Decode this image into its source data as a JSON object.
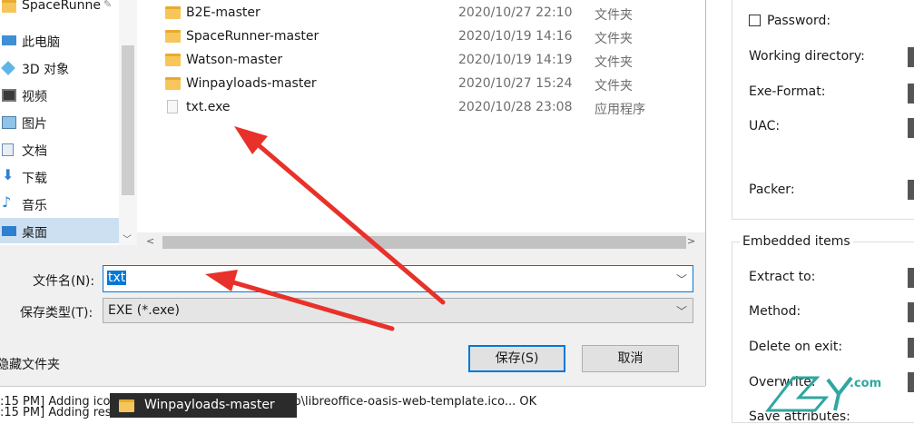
{
  "nav": {
    "items": [
      {
        "label": "SpaceRunne",
        "icon": "folder-icon"
      },
      {
        "label": "此电脑",
        "icon": "computer-icon"
      },
      {
        "label": "3D 对象",
        "icon": "cube-icon"
      },
      {
        "label": "视频",
        "icon": "video-icon"
      },
      {
        "label": "图片",
        "icon": "picture-icon"
      },
      {
        "label": "文档",
        "icon": "document-icon"
      },
      {
        "label": "下载",
        "icon": "download-icon"
      },
      {
        "label": "音乐",
        "icon": "music-icon"
      },
      {
        "label": "桌面",
        "icon": "desktop-icon"
      }
    ]
  },
  "files": [
    {
      "name": "B2E-master",
      "date": "2020/10/27 22:10",
      "type": "文件夹"
    },
    {
      "name": "SpaceRunner-master",
      "date": "2020/10/19 14:16",
      "type": "文件夹"
    },
    {
      "name": "Watson-master",
      "date": "2020/10/19 14:19",
      "type": "文件夹"
    },
    {
      "name": "Winpayloads-master",
      "date": "2020/10/27 15:24",
      "type": "文件夹"
    },
    {
      "name": "txt.exe",
      "date": "2020/10/28 23:08",
      "type": "应用程序"
    }
  ],
  "form": {
    "filename_label": "文件名(N):",
    "filename_value": "txt",
    "filetype_label": "保存类型(T):",
    "filetype_value": "EXE (*.exe)",
    "hide_folders": "隐藏文件夹",
    "save_button": "保存(S)",
    "cancel_button": "取消"
  },
  "panel": {
    "password": "Password:",
    "working_directory": "Working directory:",
    "exe_format": "Exe-Format:",
    "uac": "UAC:",
    "packer": "Packer:",
    "embedded_items": "Embedded items",
    "extract_to": "Extract to:",
    "method": "Method:",
    "delete_on_exit": "Delete on exit:",
    "overwrite": "Overwrite:",
    "save_attributes": "Save attributes:"
  },
  "log": {
    "line1": ":15 PM] Adding icon: C:\\Users\\（13223U）\\Desktop\\libreoffice-oasis-web-template.ico... OK",
    "line2": ":15 PM] Adding resources..."
  },
  "tooltip": {
    "label": "Winpayloads-master"
  },
  "watermark": {
    "text": ".com"
  },
  "colors": {
    "accent": "#0078d7",
    "arrow": "#e8312a",
    "folder": "#f6c65b"
  }
}
